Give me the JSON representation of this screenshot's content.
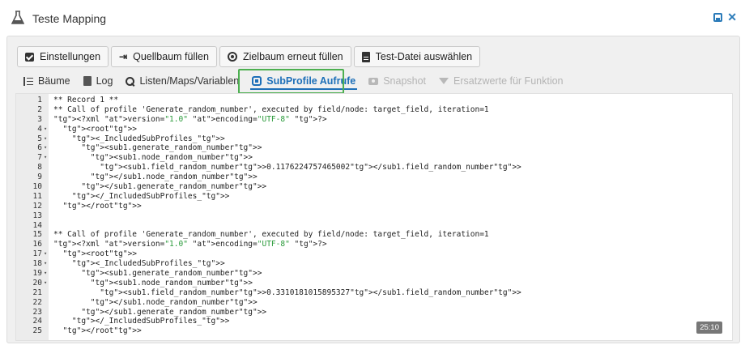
{
  "window": {
    "title": "Teste Mapping"
  },
  "toolbar": {
    "buttons": [
      {
        "label": "Einstellungen",
        "icon": "check-square-icon"
      },
      {
        "label": "Quellbaum füllen",
        "icon": "sign-in-icon"
      },
      {
        "label": "Zielbaum erneut füllen",
        "icon": "radio-dot-icon"
      },
      {
        "label": "Test-Datei auswählen",
        "icon": "file-icon"
      }
    ]
  },
  "tabs": [
    {
      "label": "Bäume",
      "icon": "tree-icon",
      "state": "normal"
    },
    {
      "label": "Log",
      "icon": "document-icon",
      "state": "normal"
    },
    {
      "label": "Listen/Maps/Variablen",
      "icon": "search-icon",
      "state": "normal"
    },
    {
      "label": "SubProfile Aufrufe",
      "icon": "subprofile-icon",
      "state": "active"
    },
    {
      "label": "Snapshot",
      "icon": "camera-icon",
      "state": "disabled"
    },
    {
      "label": "Ersatzwerte für Funktion",
      "icon": "filter-icon",
      "state": "disabled"
    }
  ],
  "editor": {
    "cursor_position": "25:10",
    "lines": [
      {
        "n": "1",
        "fold": "",
        "text": "** Record 1 **"
      },
      {
        "n": "2",
        "fold": "",
        "text": "** Call of profile 'Generate_random_number', executed by field/node: target_field, iteration=1"
      },
      {
        "n": "3",
        "fold": "",
        "text": "<?xml version=\"1.0\" encoding=\"UTF-8\" ?>"
      },
      {
        "n": "4",
        "fold": "▾",
        "text": "  <root>"
      },
      {
        "n": "5",
        "fold": "▾",
        "text": "    <_IncludedSubProfiles_>"
      },
      {
        "n": "6",
        "fold": "▾",
        "text": "      <sub1.generate_random_number>"
      },
      {
        "n": "7",
        "fold": "▾",
        "text": "        <sub1.node_random_number>"
      },
      {
        "n": "8",
        "fold": "",
        "text": "          <sub1.field_random_number>0.1176224757465002</sub1.field_random_number>"
      },
      {
        "n": "9",
        "fold": "",
        "text": "        </sub1.node_random_number>"
      },
      {
        "n": "10",
        "fold": "",
        "text": "      </sub1.generate_random_number>"
      },
      {
        "n": "11",
        "fold": "",
        "text": "    </_IncludedSubProfiles_>"
      },
      {
        "n": "12",
        "fold": "",
        "text": "  </root>"
      },
      {
        "n": "13",
        "fold": "",
        "text": ""
      },
      {
        "n": "14",
        "fold": "",
        "text": ""
      },
      {
        "n": "15",
        "fold": "",
        "text": "** Call of profile 'Generate_random_number', executed by field/node: target_field, iteration=1"
      },
      {
        "n": "16",
        "fold": "",
        "text": "<?xml version=\"1.0\" encoding=\"UTF-8\" ?>"
      },
      {
        "n": "17",
        "fold": "▾",
        "text": "  <root>"
      },
      {
        "n": "18",
        "fold": "▾",
        "text": "    <_IncludedSubProfiles_>"
      },
      {
        "n": "19",
        "fold": "▾",
        "text": "      <sub1.generate_random_number>"
      },
      {
        "n": "20",
        "fold": "▾",
        "text": "        <sub1.node_random_number>"
      },
      {
        "n": "21",
        "fold": "",
        "text": "          <sub1.field_random_number>0.3310181015895327</sub1.field_random_number>"
      },
      {
        "n": "22",
        "fold": "",
        "text": "        </sub1.node_random_number>"
      },
      {
        "n": "23",
        "fold": "",
        "text": "      </sub1.generate_random_number>"
      },
      {
        "n": "24",
        "fold": "",
        "text": "    </_IncludedSubProfiles_>"
      },
      {
        "n": "25",
        "fold": "",
        "text": "  </root>"
      }
    ]
  },
  "colors": {
    "accent": "#1d6fb8",
    "highlight": "#4caf50",
    "xml_tag": "#93267a",
    "xml_string": "#2a9a3a"
  }
}
